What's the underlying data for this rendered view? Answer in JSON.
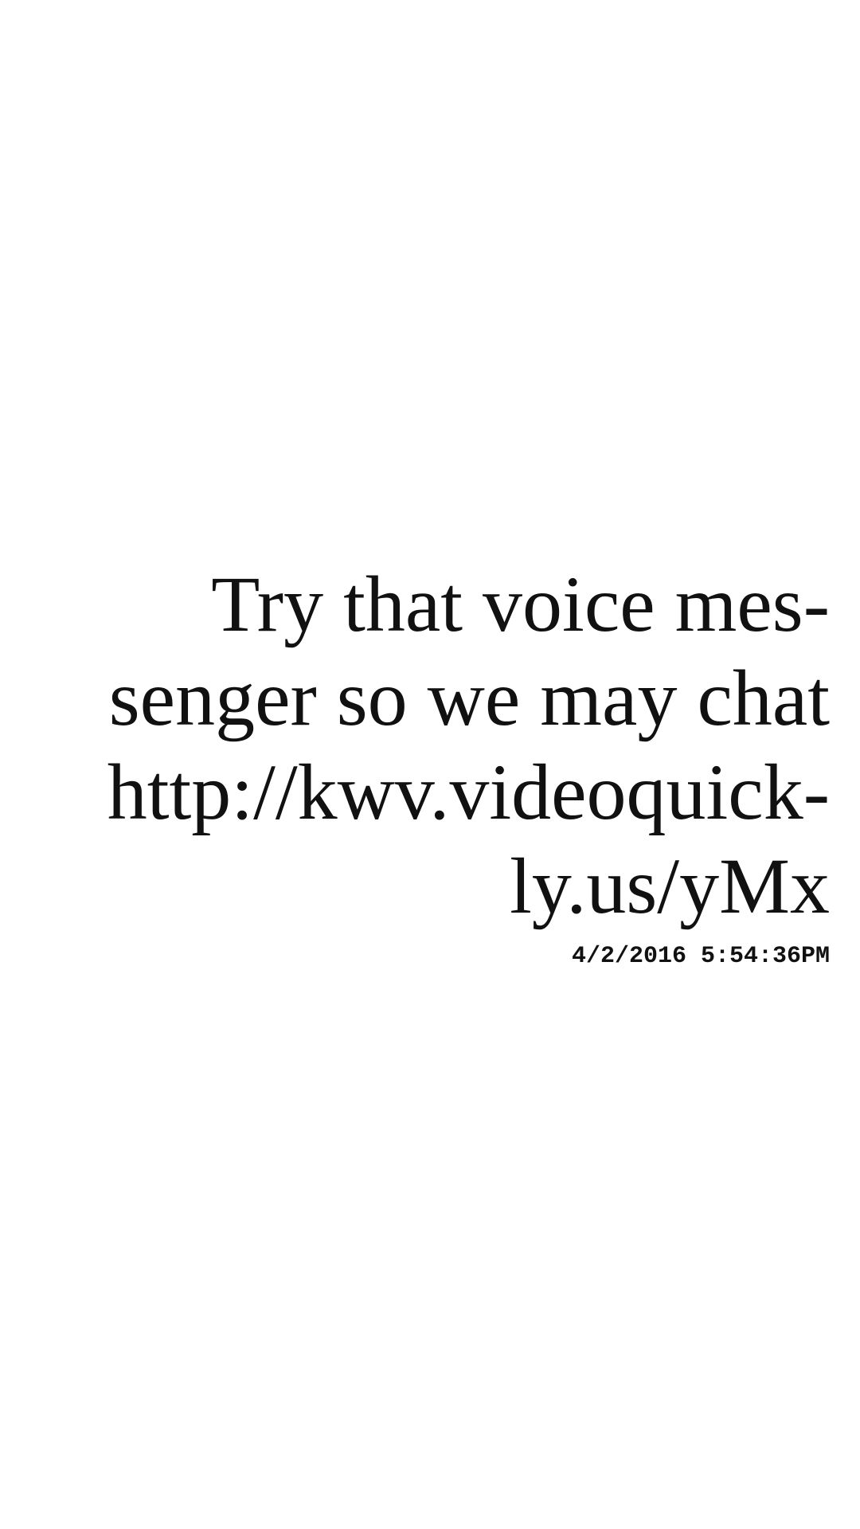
{
  "message": {
    "lines": [
      "Try that voice mes-",
      "senger so we may chat",
      "http://kwv.videoquick-",
      "ly.us/yMx"
    ],
    "timestamp": "4/2/2016 5:54:36PM"
  },
  "colors": {
    "background": "#ffffff",
    "text": "#111111"
  }
}
